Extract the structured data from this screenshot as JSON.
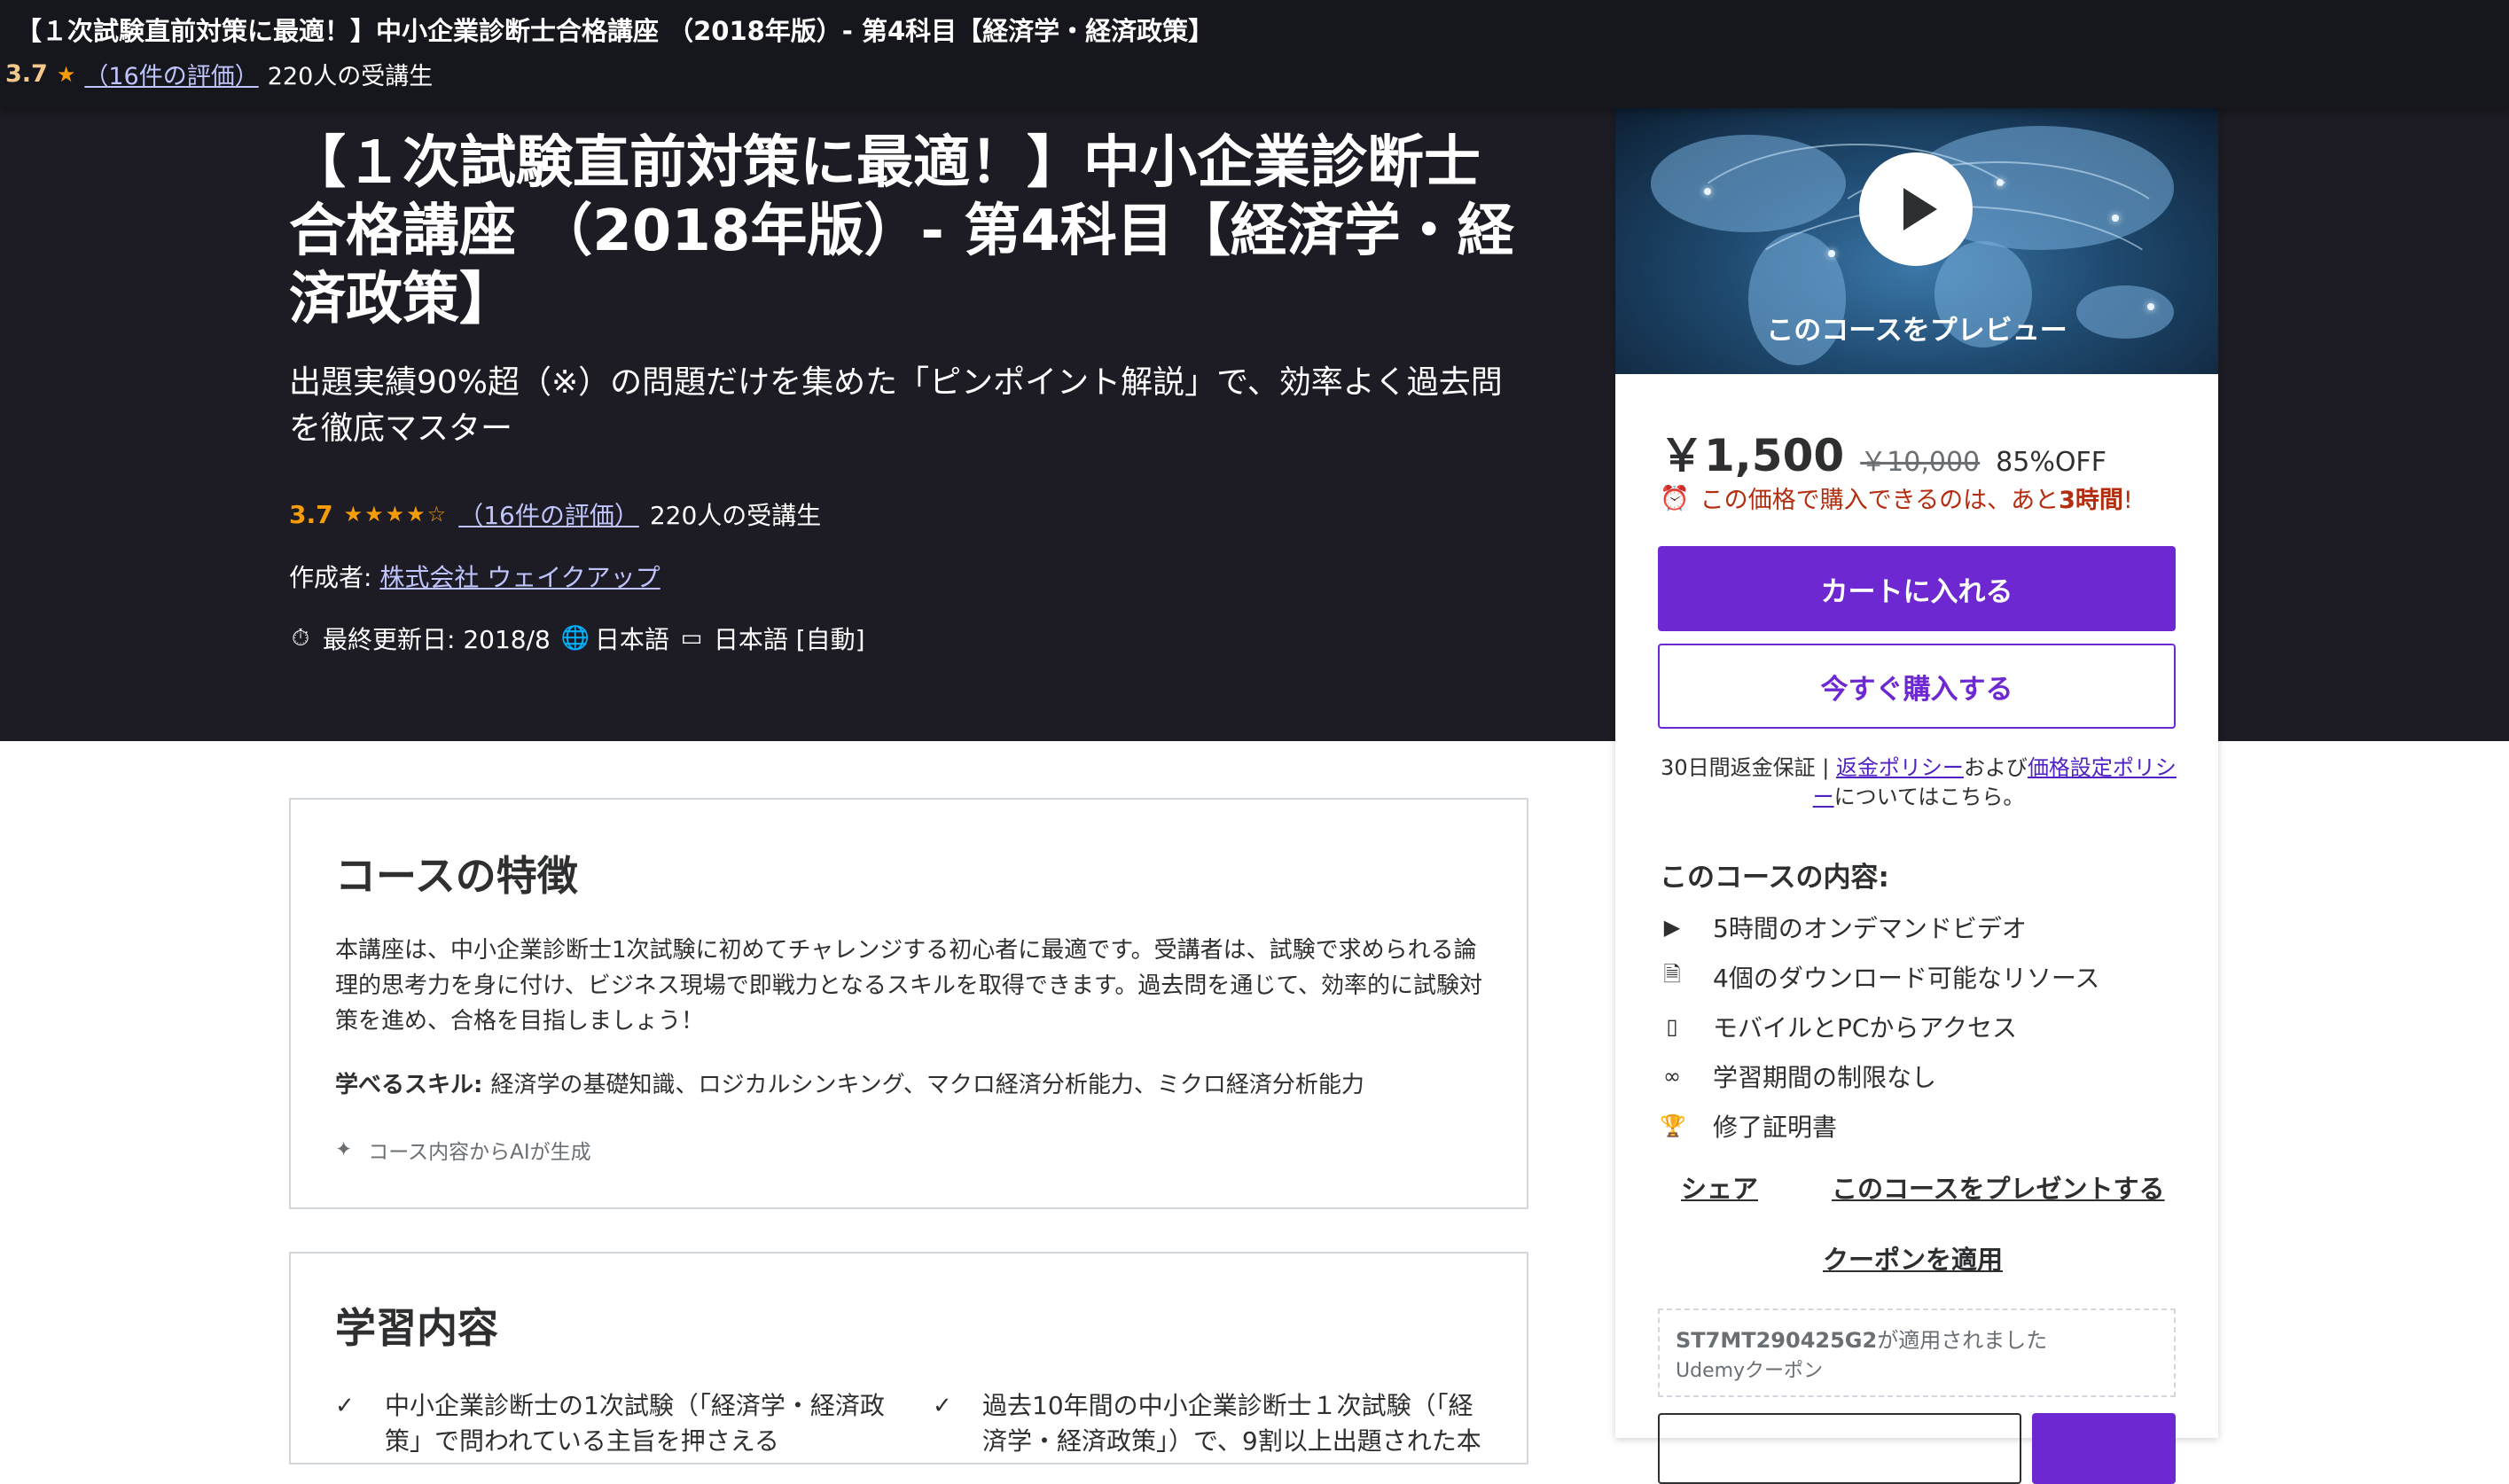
{
  "sticky": {
    "title": "【１次試験直前対策に最適！】中小企業診断士合格講座 （2018年版）- 第4科目【経済学・経済政策】",
    "rating": "3.7",
    "reviews_link": "（16件の評価）",
    "students": "220人の受講生"
  },
  "hero": {
    "title": "【１次試験直前対策に最適！】中小企業診断士合格講座 （2018年版）- 第4科目【経済学・経済政策】",
    "subtitle": "出題実績90%超（※）の問題だけを集めた「ピンポイント解説」で、効率よく過去問を徹底マスター",
    "rating": "3.7",
    "stars": "★★★★☆",
    "reviews_link": "（16件の評価）",
    "students": "220人の受講生",
    "author_label": "作成者: ",
    "author_name": "株式会社 ウェイクアップ",
    "last_updated": "最終更新日: 2018/8",
    "language": "日本語",
    "captions": "日本語 [自動]"
  },
  "features": {
    "heading": "コースの特徴",
    "body": "本講座は、中小企業診断士1次試験に初めてチャレンジする初心者に最適です。受講者は、試験で求められる論理的思考力を身に付け、ビジネス現場で即戦力となるスキルを取得できます。過去問を通じて、効率的に試験対策を進め、合格を目指しましょう！",
    "skills_label": "学べるスキル: ",
    "skills": "経済学の基礎知識、ロジカルシンキング、マクロ経済分析能力、ミクロ経済分析能力",
    "ai_note": "コース内容からAIが生成"
  },
  "learn": {
    "heading": "学習内容",
    "item1": "中小企業診断士の1次試験（「経済学・経済政策」で問われている主旨を押さえる",
    "item2": "過去10年間の中小企業診断士１次試験（「経済学・経済政策」）で、9割以上出題された本"
  },
  "sidebar": {
    "preview_label": "このコースをプレビュー",
    "price": "￥1,500",
    "price_old": "￥10,000",
    "discount": "85%OFF",
    "timer_text": "この価格で購入できるのは、あと",
    "timer_bold": "3時間",
    "timer_end": "!",
    "add_to_cart": "カートに入れる",
    "buy_now": "今すぐ購入する",
    "guarantee_prefix": "30日間返金保証 | ",
    "refund_link": "返金ポリシー",
    "and": "および",
    "pricing_link": "価格設定ポリシー",
    "guarantee_suffix": "についてはこちら。",
    "includes_heading": "このコースの内容:",
    "includes": [
      "5時間のオンデマンドビデオ",
      "4個のダウンロード可能なリソース",
      "モバイルとPCからアクセス",
      "学習期間の制限なし",
      "修了証明書"
    ],
    "share": "シェア",
    "gift": "このコースをプレゼントする",
    "apply_coupon": "クーポンを適用",
    "coupon_code": "ST7MT290425G2",
    "coupon_applied": "が適用されました",
    "coupon_type": "Udemyクーポン"
  },
  "colors": {
    "accent": "#6d28d2",
    "dark_bg": "#1d1c24",
    "rating": "#f69c08",
    "timer": "#b32d0f"
  }
}
